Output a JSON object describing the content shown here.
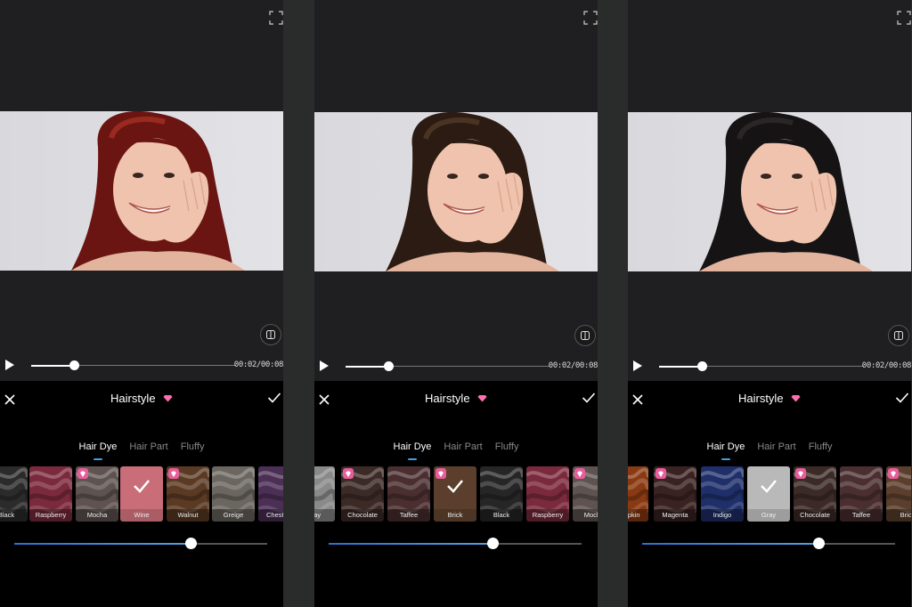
{
  "panels": [
    {
      "time": "00:02/00:08",
      "title": "Hairstyle",
      "tabs": [
        {
          "label": "Hair Dye",
          "active": true
        },
        {
          "label": "Hair Part",
          "active": false
        },
        {
          "label": "Fluffy",
          "active": false
        }
      ],
      "playback_progress": 0.21,
      "intensity": 0.7,
      "hair_color": "#6a1511",
      "hair_highlight": "#9a2a20",
      "swatches": [
        {
          "label": "Black",
          "color": "#2b2b2b",
          "vip": false,
          "selected": false
        },
        {
          "label": "Raspberry",
          "color": "#7a2a3c",
          "vip": false,
          "selected": false
        },
        {
          "label": "Mocha",
          "color": "#5e5350",
          "vip": true,
          "selected": false
        },
        {
          "label": "Wine",
          "color": "#c96e78",
          "vip": false,
          "selected": true
        },
        {
          "label": "Walnut",
          "color": "#5a3a23",
          "vip": true,
          "selected": false
        },
        {
          "label": "Greige",
          "color": "#6b6660",
          "vip": false,
          "selected": false
        },
        {
          "label": "Chestnut",
          "color": "#4b2f55",
          "vip": false,
          "selected": false
        }
      ]
    },
    {
      "time": "00:02/00:08",
      "title": "Hairstyle",
      "tabs": [
        {
          "label": "Hair Dye",
          "active": true
        },
        {
          "label": "Hair Part",
          "active": false
        },
        {
          "label": "Fluffy",
          "active": false
        }
      ],
      "playback_progress": 0.21,
      "intensity": 0.65,
      "hair_color": "#2b1b12",
      "hair_highlight": "#4a3323",
      "swatches": [
        {
          "label": "Gray",
          "color": "#8a8a8a",
          "vip": false,
          "selected": false
        },
        {
          "label": "Chocolate",
          "color": "#3b2a26",
          "vip": true,
          "selected": false
        },
        {
          "label": "Taffee",
          "color": "#4a2e30",
          "vip": false,
          "selected": false
        },
        {
          "label": "Brick",
          "color": "#5b3f2c",
          "vip": true,
          "selected": true
        },
        {
          "label": "Black",
          "color": "#262626",
          "vip": false,
          "selected": false
        },
        {
          "label": "Raspberry",
          "color": "#7a2a3c",
          "vip": false,
          "selected": false
        },
        {
          "label": "Mocha",
          "color": "#5e5350",
          "vip": true,
          "selected": false
        }
      ]
    },
    {
      "time": "00:02/00:08",
      "title": "Hairstyle",
      "tabs": [
        {
          "label": "Hair Dye",
          "active": true
        },
        {
          "label": "Hair Part",
          "active": false
        },
        {
          "label": "Fluffy",
          "active": false
        }
      ],
      "playback_progress": 0.21,
      "intensity": 0.7,
      "hair_color": "#151313",
      "hair_highlight": "#2a2626",
      "swatches": [
        {
          "label": "Pumpkin",
          "color": "#8a3a12",
          "vip": false,
          "selected": false
        },
        {
          "label": "Magenta",
          "color": "#3a2222",
          "vip": true,
          "selected": false
        },
        {
          "label": "Indigo",
          "color": "#1f2f6a",
          "vip": false,
          "selected": false
        },
        {
          "label": "Gray",
          "color": "#b9b9b9",
          "vip": false,
          "selected": true
        },
        {
          "label": "Chocolate",
          "color": "#3b2a26",
          "vip": true,
          "selected": false
        },
        {
          "label": "Taffee",
          "color": "#4a2e30",
          "vip": false,
          "selected": false
        },
        {
          "label": "Brick",
          "color": "#5b3f2c",
          "vip": true,
          "selected": false
        }
      ]
    }
  ],
  "colors": {
    "accent": "#3f9fe7",
    "vip_badge": "#e85d9b",
    "gem": "#ff6fae"
  },
  "icons": {
    "play": "play-icon",
    "close": "close-icon",
    "confirm": "check-icon",
    "compare": "compare-icon",
    "fullscreen": "fullscreen-icon",
    "vip": "gem-icon"
  }
}
